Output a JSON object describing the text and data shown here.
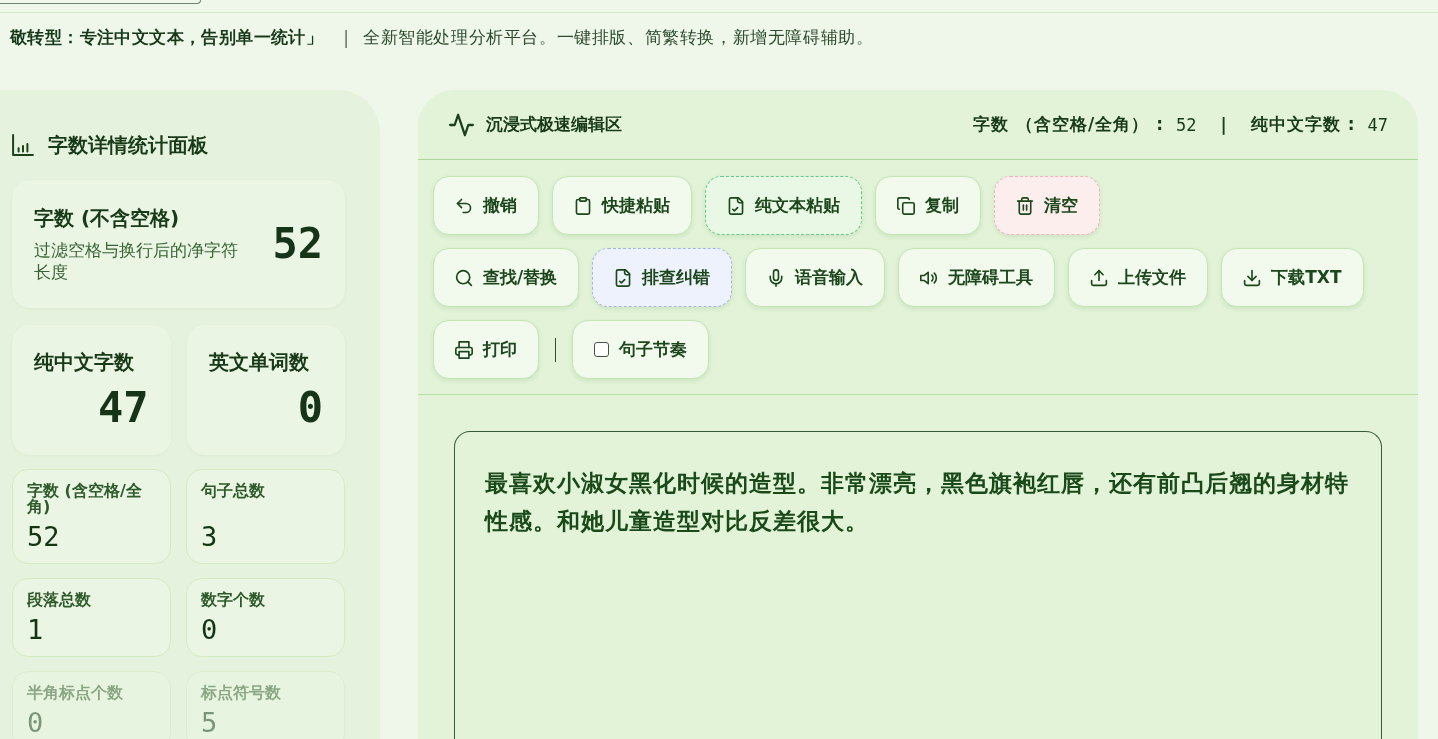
{
  "announcement": {
    "headline": "敬转型：专注中文文本，告别单一统计」",
    "divider": "|",
    "text": "全新智能处理分析平台。一键排版、简繁转换，新增无障碍辅助。"
  },
  "stats_panel": {
    "title": "字数详情统计面板",
    "primary": {
      "label": "字数 (不含空格)",
      "description": "过滤空格与换行后的净字符长度",
      "value": "52"
    },
    "highlights": [
      {
        "label": "纯中文字数",
        "value": "47"
      },
      {
        "label": "英文单词数",
        "value": "0"
      }
    ],
    "details": [
      {
        "label": "字数 (含空格/全角)",
        "value": "52"
      },
      {
        "label": "句子总数",
        "value": "3"
      },
      {
        "label": "段落总数",
        "value": "1"
      },
      {
        "label": "数字个数",
        "value": "0"
      },
      {
        "label": "半角标点个数",
        "value": "0"
      },
      {
        "label": "标点符号数",
        "value": "5"
      }
    ]
  },
  "editor_panel": {
    "title": "沉浸式极速编辑区",
    "counters": [
      {
        "label": "字数 （含空格/全角） :",
        "value": "52"
      },
      {
        "label": "纯中文字数 :",
        "value": "47"
      }
    ],
    "counter_divider": "|",
    "toolbar_rows": [
      {
        "items": [
          {
            "kind": "plain",
            "label": "撤销"
          },
          {
            "kind": "plain",
            "label": "快捷粘贴"
          },
          {
            "kind": "accent",
            "label": "纯文本粘贴"
          },
          {
            "kind": "plain",
            "label": "复制"
          },
          {
            "kind": "danger",
            "label": "清空"
          }
        ]
      },
      {
        "items": [
          {
            "kind": "plain",
            "label": "查找/替换"
          },
          {
            "kind": "highlight",
            "label": "排查纠错"
          },
          {
            "kind": "plain",
            "label": "语音输入"
          },
          {
            "kind": "plain",
            "label": "无障碍工具"
          },
          {
            "kind": "plain",
            "label": "上传文件"
          },
          {
            "kind": "plain",
            "label": "下载TXT"
          }
        ]
      },
      {
        "items": [
          {
            "kind": "plain",
            "label": "打印"
          },
          {
            "kind": "divider"
          },
          {
            "kind": "toggle",
            "label": "句子节奏",
            "checked": false
          }
        ]
      }
    ],
    "editor": {
      "value": "最喜欢小淑女黑化时候的造型。非常漂亮，黑色旗袍红唇，还有前凸后翘的身材特性感。和她儿童造型对比反差很大。"
    }
  }
}
